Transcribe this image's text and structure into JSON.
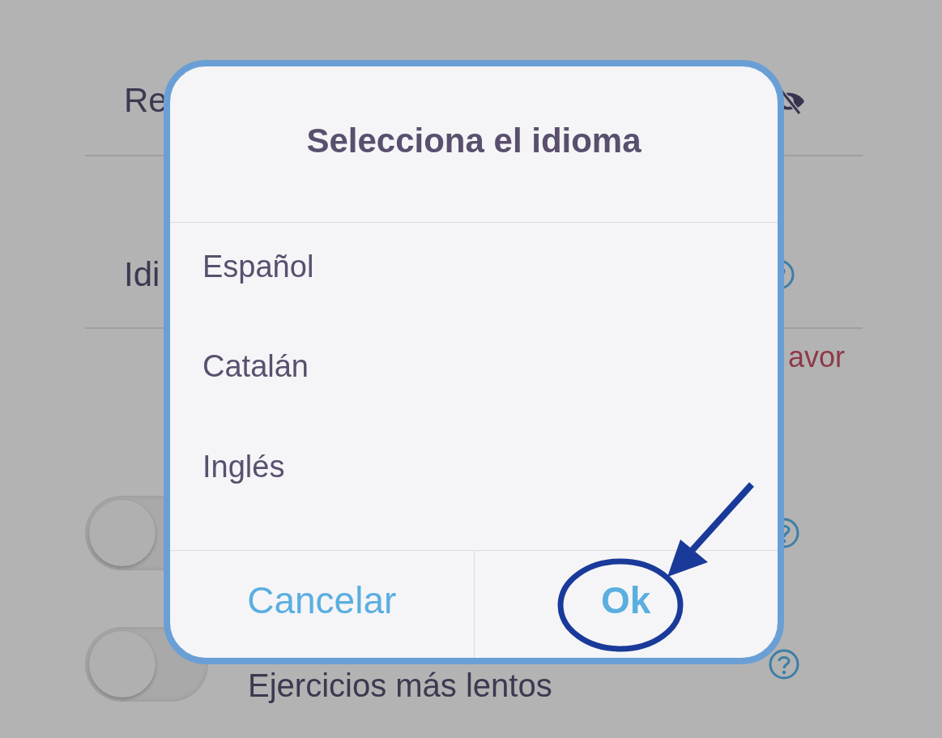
{
  "settings": {
    "rows": [
      {
        "kind": "password",
        "label": "Re"
      },
      {
        "kind": "language",
        "label": "Idi"
      }
    ],
    "notice": "avor",
    "toggles": [
      {
        "on": false
      },
      {
        "label": "Ejercicios más lentos",
        "on": false
      }
    ]
  },
  "dialog": {
    "title": "Selecciona el idioma",
    "options": [
      {
        "label": "Español"
      },
      {
        "label": "Catalán"
      },
      {
        "label": "Inglés"
      }
    ],
    "buttons": [
      {
        "kind": "cancel",
        "label": "Cancelar",
        "highlighted": false
      },
      {
        "kind": "confirm",
        "label": "Ok",
        "highlighted": true
      }
    ]
  }
}
